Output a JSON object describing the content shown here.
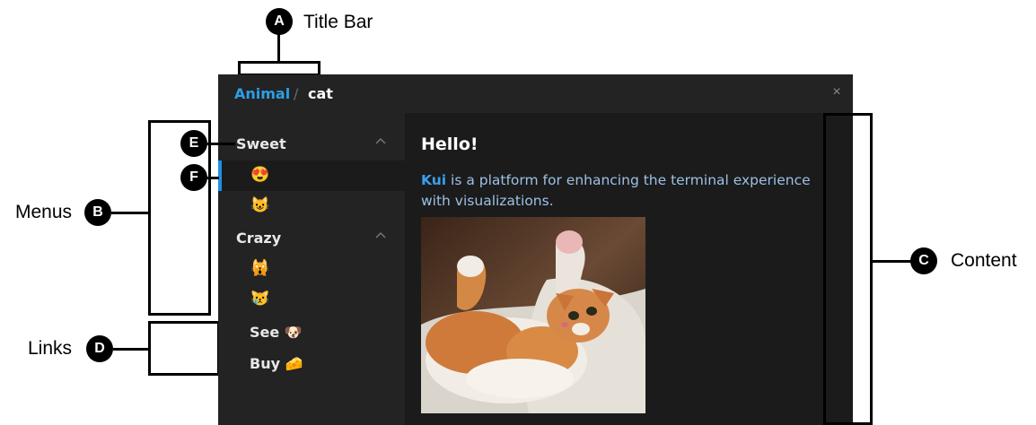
{
  "annotations": {
    "a": {
      "badge": "A",
      "label": "Title Bar"
    },
    "b": {
      "badge": "B",
      "label": "Menus"
    },
    "c": {
      "badge": "C",
      "label": "Content"
    },
    "d": {
      "badge": "D",
      "label": "Links"
    },
    "e": {
      "badge": "E"
    },
    "f": {
      "badge": "F"
    }
  },
  "window": {
    "breadcrumb": {
      "root": "Animal",
      "separator": "/",
      "leaf": "cat"
    },
    "close_icon": "×",
    "groups": [
      {
        "label": "Sweet",
        "items": [
          "😍",
          "😺"
        ]
      },
      {
        "label": "Crazy",
        "items": [
          "🙀",
          "😿"
        ]
      }
    ],
    "links": [
      {
        "text": "See",
        "emoji": "🐶"
      },
      {
        "text": "Buy",
        "emoji": "🧀"
      }
    ],
    "content": {
      "title": "Hello!",
      "brand": "Kui",
      "paragraph": " is a platform for enhancing the terminal experience with visualizations."
    }
  },
  "colors": {
    "accent": "#1e90e6",
    "window_bg": "#232323",
    "content_bg": "#1b1b1b"
  }
}
